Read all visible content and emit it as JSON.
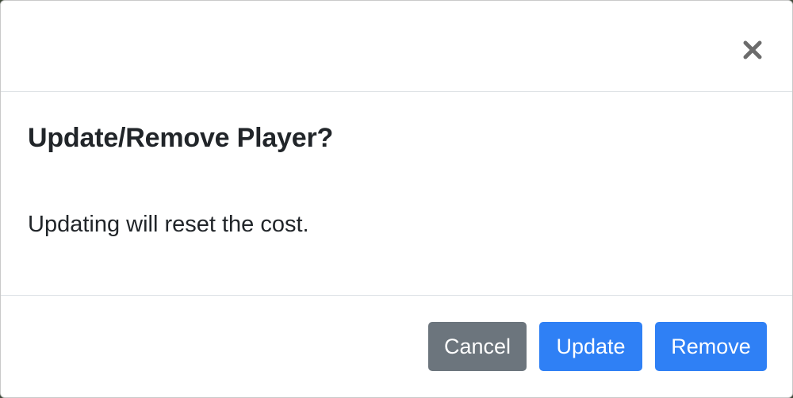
{
  "modal": {
    "title": "Update/Remove Player?",
    "message": "Updating will reset the cost.",
    "close_label": "Close"
  },
  "footer": {
    "cancel_label": "Cancel",
    "update_label": "Update",
    "remove_label": "Remove"
  },
  "colors": {
    "primary": "#2f80f5",
    "secondary": "#6c757d",
    "text": "#212529",
    "close_icon": "#6c6c6c"
  },
  "icons": {
    "close": "close-icon"
  }
}
